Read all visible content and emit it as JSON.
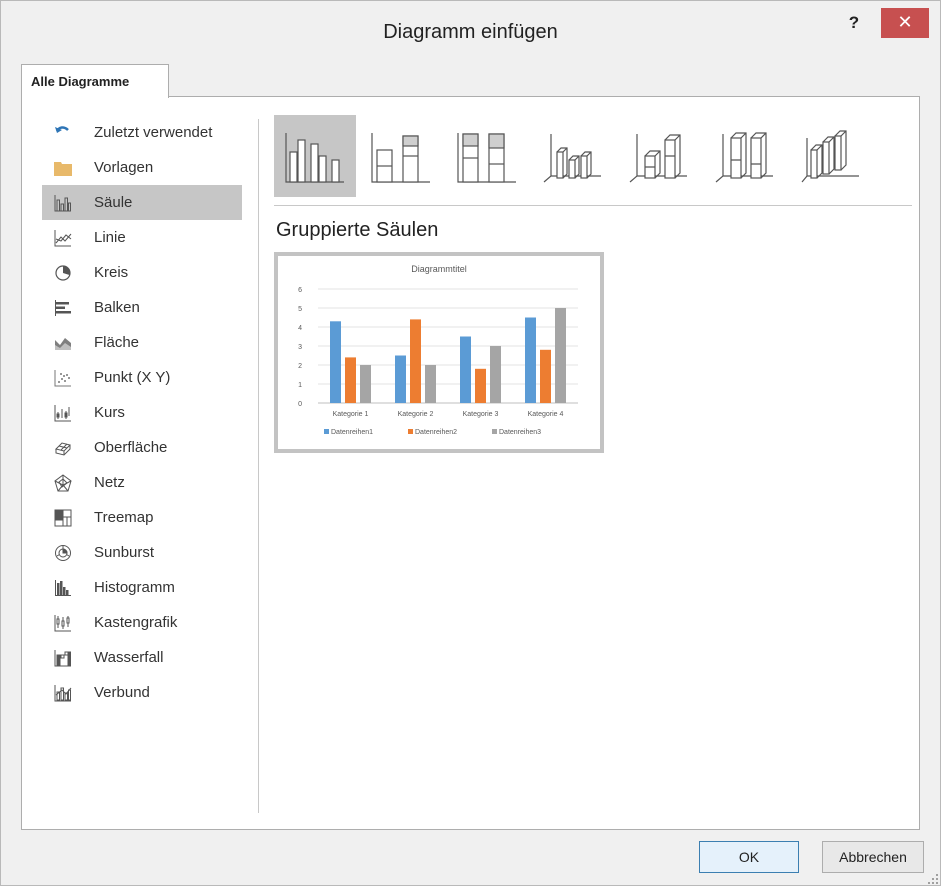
{
  "dialog": {
    "title": "Diagramm einfügen",
    "help_label": "?",
    "close_label": "✕"
  },
  "tabs": [
    {
      "label": "Alle Diagramme",
      "active": true
    }
  ],
  "sidebar": {
    "items": [
      {
        "label": "Zuletzt verwendet",
        "icon": "undo-arrow-icon"
      },
      {
        "label": "Vorlagen",
        "icon": "folder-icon"
      },
      {
        "label": "Säule",
        "icon": "column-chart-icon",
        "selected": true
      },
      {
        "label": "Linie",
        "icon": "line-chart-icon"
      },
      {
        "label": "Kreis",
        "icon": "pie-chart-icon"
      },
      {
        "label": "Balken",
        "icon": "bar-chart-icon"
      },
      {
        "label": "Fläche",
        "icon": "area-chart-icon"
      },
      {
        "label": "Punkt (X Y)",
        "icon": "scatter-chart-icon"
      },
      {
        "label": "Kurs",
        "icon": "stock-chart-icon"
      },
      {
        "label": "Oberfläche",
        "icon": "surface-chart-icon"
      },
      {
        "label": "Netz",
        "icon": "radar-chart-icon"
      },
      {
        "label": "Treemap",
        "icon": "treemap-icon"
      },
      {
        "label": "Sunburst",
        "icon": "sunburst-icon"
      },
      {
        "label": "Histogramm",
        "icon": "histogram-icon"
      },
      {
        "label": "Kastengrafik",
        "icon": "box-whisker-icon"
      },
      {
        "label": "Wasserfall",
        "icon": "waterfall-icon"
      },
      {
        "label": "Verbund",
        "icon": "combo-chart-icon"
      }
    ]
  },
  "subtypes": [
    {
      "icon": "clustered-column-icon",
      "selected": true
    },
    {
      "icon": "stacked-column-icon"
    },
    {
      "icon": "stacked-100-column-icon"
    },
    {
      "icon": "3d-clustered-column-icon"
    },
    {
      "icon": "3d-stacked-column-icon"
    },
    {
      "icon": "3d-stacked-100-column-icon"
    },
    {
      "icon": "3d-column-icon"
    }
  ],
  "section_title": "Gruppierte Säulen",
  "chart_data": {
    "type": "bar",
    "title": "Diagrammtitel",
    "categories": [
      "Kategorie 1",
      "Kategorie 2",
      "Kategorie 3",
      "Kategorie 4"
    ],
    "series": [
      {
        "name": "Datenreihen1",
        "values": [
          4.3,
          2.5,
          3.5,
          4.5
        ],
        "color": "#5b9bd5"
      },
      {
        "name": "Datenreihen2",
        "values": [
          2.4,
          4.4,
          1.8,
          2.8
        ],
        "color": "#ed7d31"
      },
      {
        "name": "Datenreihen3",
        "values": [
          2.0,
          2.0,
          3.0,
          5.0
        ],
        "color": "#a5a5a5"
      }
    ],
    "ylim": [
      0,
      6
    ],
    "yticks": [
      "0",
      "1",
      "2",
      "3",
      "4",
      "5",
      "6"
    ],
    "grid": true,
    "legend": "bottom"
  },
  "buttons": {
    "ok": "OK",
    "cancel": "Abbrechen"
  }
}
